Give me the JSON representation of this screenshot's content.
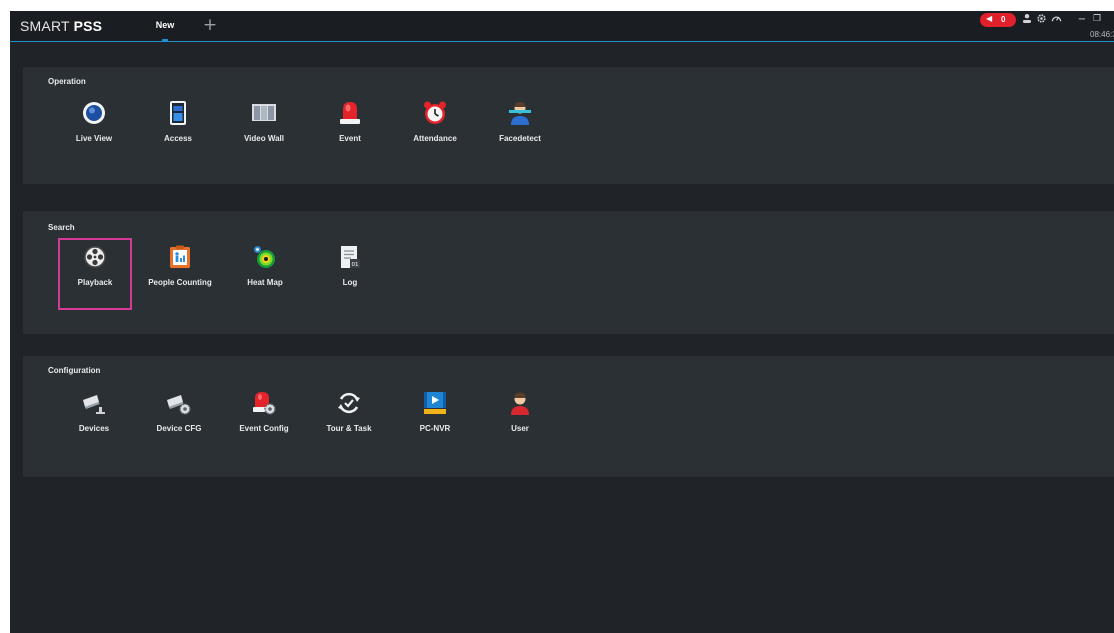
{
  "app": {
    "brand_prefix": "SMART ",
    "brand_suffix": "PSS"
  },
  "tabs": [
    {
      "label": "New",
      "active": true
    }
  ],
  "add_tab_symbol": "+",
  "status": {
    "alarm_count": "0",
    "clock": "08:46:3",
    "alarm_color": "#e0202a",
    "accent_color": "#1e8fcf"
  },
  "window_controls": {
    "minimize": "−",
    "restore": "❐"
  },
  "sections": {
    "operation": {
      "title": "Operation",
      "items": [
        {
          "label": "Live View",
          "icon": "live-view-icon"
        },
        {
          "label": "Access",
          "icon": "access-icon"
        },
        {
          "label": "Video Wall",
          "icon": "video-wall-icon"
        },
        {
          "label": "Event",
          "icon": "event-icon"
        },
        {
          "label": "Attendance",
          "icon": "attendance-icon"
        },
        {
          "label": "Facedetect",
          "icon": "facedetect-icon"
        }
      ]
    },
    "search": {
      "title": "Search",
      "items": [
        {
          "label": "Playback",
          "icon": "playback-icon",
          "selected": true
        },
        {
          "label": "People Counting",
          "icon": "people-counting-icon"
        },
        {
          "label": "Heat Map",
          "icon": "heat-map-icon"
        },
        {
          "label": "Log",
          "icon": "log-icon"
        }
      ]
    },
    "configuration": {
      "title": "Configuration",
      "items": [
        {
          "label": "Devices",
          "icon": "devices-icon"
        },
        {
          "label": "Device CFG",
          "icon": "device-cfg-icon"
        },
        {
          "label": "Event Config",
          "icon": "event-config-icon"
        },
        {
          "label": "Tour & Task",
          "icon": "tour-task-icon"
        },
        {
          "label": "PC-NVR",
          "icon": "pc-nvr-icon"
        },
        {
          "label": "User",
          "icon": "user-icon"
        }
      ]
    }
  },
  "highlight_color": "#d63a97"
}
